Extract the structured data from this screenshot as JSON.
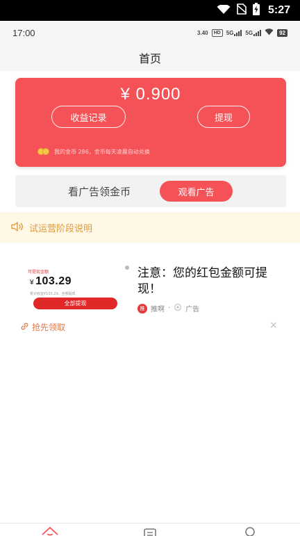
{
  "system_bar": {
    "clock": "5:27",
    "icons": [
      "wifi-icon",
      "sim-off-icon",
      "battery-charging-icon"
    ]
  },
  "app_status": {
    "time": "17:00",
    "net_speed": "3.40",
    "hd_label": "HD",
    "sig1_label": "5G",
    "sig2_label": "5G",
    "battery": "92"
  },
  "header": {
    "title": "首页"
  },
  "balance": {
    "amount": "¥ 0.900",
    "records_label": "收益记录",
    "withdraw_label": "提现",
    "coins_text": "我的金币 286，金币每天凌晨自动兑换"
  },
  "watch_ads": {
    "text": "看广告领金币",
    "button_label": "观看广告"
  },
  "notice": {
    "text": "试运营阶段说明"
  },
  "ad": {
    "thumb_label": "可提现金额",
    "thumb_currency": "¥",
    "thumb_amount": "103.29",
    "thumb_sub": "累计收益¥103.29，全部提现",
    "thumb_button": "全部提现",
    "headline": "注意：您的红包金额可提现！",
    "source": "推啊",
    "source_sep": "·",
    "tag": "广告",
    "link_label": "抢先领取",
    "close_label": "×"
  },
  "colors": {
    "primary_red": "#f45256",
    "notice_bg": "#fff8e6",
    "notice_text": "#e09a3d",
    "coin": "#f7c64a"
  },
  "bottom_nav": {
    "icons": [
      "home-icon",
      "list-icon",
      "profile-icon"
    ]
  }
}
